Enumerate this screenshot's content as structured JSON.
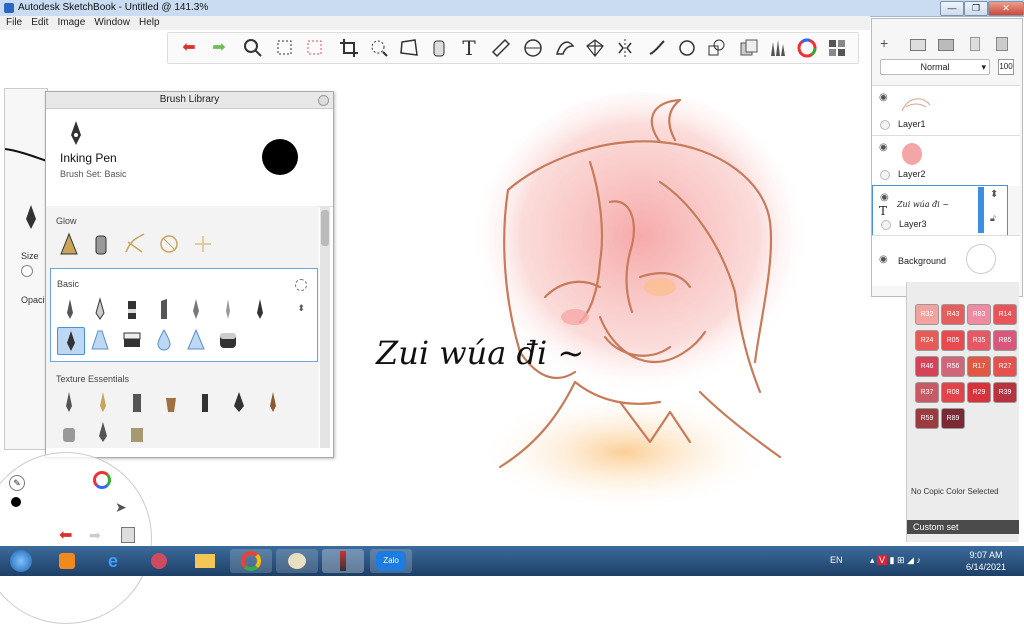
{
  "window": {
    "title": "Autodesk SketchBook - Untitled @ 141.3%",
    "minimize": "—",
    "maximize": "❐",
    "close": "✕"
  },
  "menu": [
    "File",
    "Edit",
    "Image",
    "Window",
    "Help"
  ],
  "left_panel": {
    "size_label": "Size",
    "opacity_label": "Opacit"
  },
  "brush_library": {
    "title": "Brush Library",
    "selected_brush": "Inking Pen",
    "brush_set": "Brush Set: Basic",
    "sections": [
      "Glow",
      "Basic",
      "Texture Essentials"
    ]
  },
  "layers": {
    "blend_mode": "Normal",
    "opacity": "100",
    "items": [
      {
        "name": "Layer1"
      },
      {
        "name": "Layer2"
      },
      {
        "name": "Layer3",
        "thumb_text": "Zui wúa đi ~"
      },
      {
        "name": "Background"
      }
    ]
  },
  "canvas": {
    "text": "Zui wúa đi ~"
  },
  "copic": {
    "swatches": [
      {
        "label": "R32",
        "color": "#f2a3a0"
      },
      {
        "label": "R43",
        "color": "#e65d5d"
      },
      {
        "label": "R83",
        "color": "#f08aa0"
      },
      {
        "label": "R14",
        "color": "#e8545a"
      },
      {
        "label": "R24",
        "color": "#e85a55"
      },
      {
        "label": "R05",
        "color": "#e84a4e"
      },
      {
        "label": "R35",
        "color": "#e55864"
      },
      {
        "label": "R85",
        "color": "#d9577a"
      },
      {
        "label": "R46",
        "color": "#d5435a"
      },
      {
        "label": "R56",
        "color": "#d0667a"
      },
      {
        "label": "R17",
        "color": "#e05a43"
      },
      {
        "label": "R27",
        "color": "#e4524f"
      },
      {
        "label": "R37",
        "color": "#c75a64"
      },
      {
        "label": "R08",
        "color": "#e3434a"
      },
      {
        "label": "R29",
        "color": "#d8323d"
      },
      {
        "label": "R39",
        "color": "#b5343f"
      },
      {
        "label": "R59",
        "color": "#9a3b40"
      },
      {
        "label": "R89",
        "color": "#7a2a35"
      }
    ],
    "no_color_text": "No Copic Color Selected",
    "custom_set": "Custom set"
  },
  "taskbar": {
    "lang": "EN",
    "time": "9:07 AM",
    "date": "6/14/2021",
    "zalo_label": "Zalo"
  }
}
